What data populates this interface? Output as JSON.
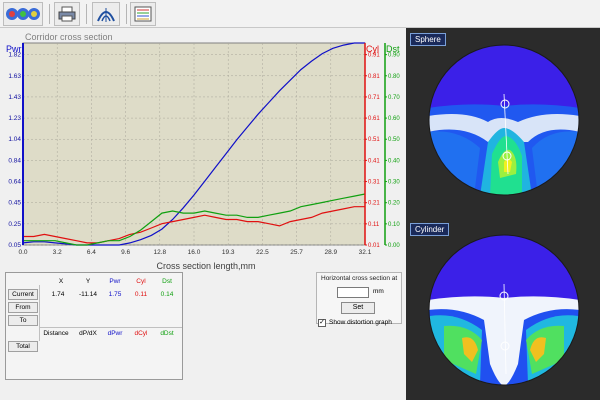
{
  "toolbar": {
    "buttons": [
      {
        "icon": "lens-maps-icon"
      },
      {
        "icon": "printer-icon"
      },
      {
        "icon": "lens-profile-icon"
      },
      {
        "icon": "chart-icon"
      }
    ]
  },
  "chart_data": {
    "type": "line",
    "title": "Corridor cross section",
    "xlabel": "Cross section length,mm",
    "x_ticks": [
      "0.0",
      "3.2",
      "6.4",
      "9.6",
      "12.8",
      "16.0",
      "19.3",
      "22.5",
      "25.7",
      "28.9",
      "32.1"
    ],
    "xlim": [
      0.0,
      32.1
    ],
    "axes": [
      {
        "name": "Pwr",
        "color": "#1010c8",
        "ylim": [
          0.05,
          1.95
        ],
        "ticks": [
          "0.05",
          "0.25",
          "0.45",
          "0.64",
          "0.84",
          "1.04",
          "1.23",
          "1.43",
          "1.63",
          "1.82"
        ]
      },
      {
        "name": "Cyl",
        "color": "#e01010",
        "ylim": [
          0.01,
          0.96
        ],
        "ticks": [
          "0.01",
          "0.11",
          "0.21",
          "0.31",
          "0.41",
          "0.51",
          "0.61",
          "0.71",
          "0.81",
          "0.91"
        ]
      },
      {
        "name": "Dst",
        "color": "#10a010",
        "ylim": [
          0.0,
          0.95
        ],
        "ticks": [
          "0.00",
          "0.10",
          "0.20",
          "0.30",
          "0.40",
          "0.50",
          "0.60",
          "0.70",
          "0.80",
          "0.90"
        ]
      }
    ],
    "series": [
      {
        "name": "Pwr",
        "color": "#1010c8",
        "axis": 0,
        "x": [
          0,
          1,
          2,
          3,
          4,
          5,
          6,
          7,
          8,
          9,
          10,
          11,
          12,
          13,
          14,
          15,
          16,
          17,
          18,
          19,
          20,
          21,
          22,
          23,
          24,
          25,
          26,
          27,
          28,
          29,
          30,
          31,
          32
        ],
        "y": [
          0.07,
          0.08,
          0.08,
          0.07,
          0.06,
          0.05,
          0.05,
          0.05,
          0.05,
          0.05,
          0.07,
          0.1,
          0.14,
          0.2,
          0.29,
          0.4,
          0.52,
          0.65,
          0.78,
          0.91,
          1.04,
          1.16,
          1.28,
          1.39,
          1.5,
          1.6,
          1.7,
          1.78,
          1.85,
          1.9,
          1.93,
          1.95,
          1.95
        ]
      },
      {
        "name": "Cyl",
        "color": "#e01010",
        "axis": 1,
        "x": [
          0,
          1,
          2,
          3,
          4,
          5,
          6,
          7,
          8,
          9,
          10,
          11,
          12,
          13,
          14,
          15,
          16,
          17,
          18,
          19,
          20,
          21,
          22,
          23,
          24,
          25,
          26,
          27,
          28,
          29,
          30,
          31,
          32
        ],
        "y": [
          0.05,
          0.05,
          0.06,
          0.05,
          0.04,
          0.03,
          0.02,
          0.02,
          0.03,
          0.04,
          0.06,
          0.07,
          0.09,
          0.11,
          0.12,
          0.13,
          0.14,
          0.15,
          0.14,
          0.13,
          0.13,
          0.12,
          0.12,
          0.11,
          0.1,
          0.12,
          0.13,
          0.14,
          0.16,
          0.17,
          0.18,
          0.19,
          0.19
        ]
      },
      {
        "name": "Dst",
        "color": "#10a010",
        "axis": 2,
        "x": [
          0,
          1,
          2,
          3,
          4,
          5,
          6,
          7,
          8,
          9,
          10,
          11,
          12,
          13,
          14,
          15,
          16,
          17,
          18,
          19,
          20,
          21,
          22,
          23,
          24,
          25,
          26,
          27,
          28,
          29,
          30,
          31,
          32
        ],
        "y": [
          0.02,
          0.02,
          0.02,
          0.02,
          0.01,
          0.0,
          0.0,
          0.01,
          0.02,
          0.02,
          0.04,
          0.07,
          0.11,
          0.15,
          0.16,
          0.15,
          0.15,
          0.16,
          0.15,
          0.14,
          0.14,
          0.13,
          0.13,
          0.14,
          0.15,
          0.16,
          0.18,
          0.19,
          0.2,
          0.21,
          0.22,
          0.23,
          0.24
        ]
      }
    ]
  },
  "table": {
    "col_headers": [
      "X",
      "Y",
      "Pwr",
      "Cyl",
      "Dst"
    ],
    "row_buttons": [
      "Current",
      "From",
      "To"
    ],
    "current_values": [
      "1.74",
      "-11.14",
      "1.75",
      "0.11",
      "0.14"
    ],
    "delta_headers": [
      "Distance",
      "dP/dX",
      "dPwr",
      "dCyl",
      "dDst"
    ],
    "total_button": "Total",
    "colors": {
      "Pwr": "#1010c8",
      "Cyl": "#e01010",
      "Dst": "#10a010"
    }
  },
  "horizontal_section": {
    "title": "Horizontal cross section at",
    "value": "",
    "unit": "mm",
    "set_label": "Set",
    "checkbox_checked": true,
    "checkbox_label": "Show distortion graph"
  },
  "maps": [
    {
      "title": "Sphere"
    },
    {
      "title": "Cylinder"
    }
  ]
}
